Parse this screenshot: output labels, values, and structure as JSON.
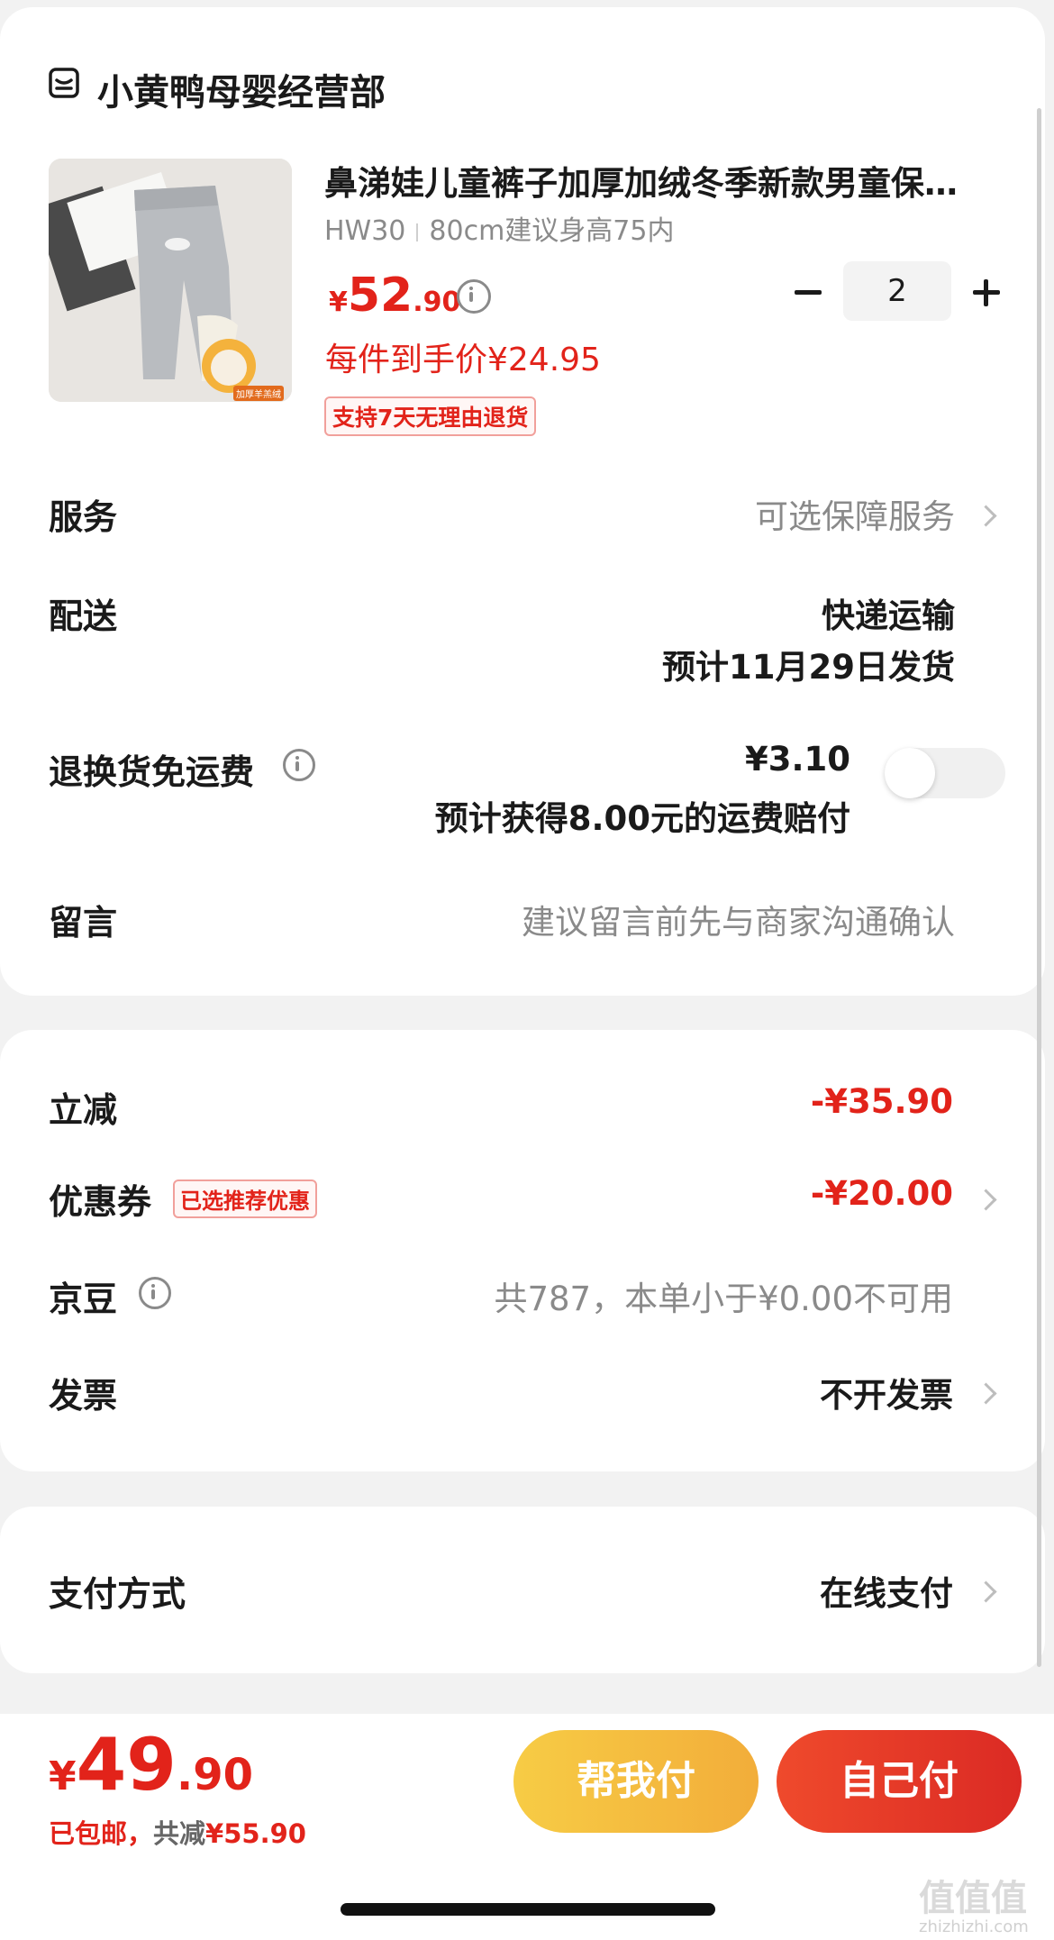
{
  "shop": {
    "name": "小黄鸭母婴经营部",
    "icon": "store-icon"
  },
  "product": {
    "title": "鼻涕娃儿童裤子加厚加绒冬季新款男童保…",
    "sku_code": "HW30",
    "sku_desc": "80cm建议身高75内",
    "price_symbol": "¥",
    "price_int": "52",
    "price_dec": ".90",
    "unit_price_label": "每件到手价¥24.95",
    "return_policy_tag": "支持7天无理由退货",
    "thumbnail_badge": "加厚羊羔绒",
    "quantity": "2"
  },
  "service": {
    "label": "服务",
    "value": "可选保障服务"
  },
  "delivery": {
    "label": "配送",
    "method": "快递运输",
    "eta": "预计11月29日发货"
  },
  "return_shipping": {
    "label": "退换货免运费",
    "price": "¥3.10",
    "desc": "预计获得8.00元的运费赔付",
    "enabled": false
  },
  "message": {
    "label": "留言",
    "placeholder": "建议留言前先与商家沟通确认"
  },
  "discounts": {
    "instant_label": "立减",
    "instant_value": "-¥35.90",
    "coupon_label": "优惠券",
    "coupon_tag": "已选推荐优惠",
    "coupon_value": "-¥20.00",
    "jingdou_label": "京豆",
    "jingdou_value": "共787，本单小于¥0.00不可用",
    "invoice_label": "发票",
    "invoice_value": "不开发票"
  },
  "payment": {
    "label": "支付方式",
    "value": "在线支付"
  },
  "footer": {
    "total_symbol": "¥",
    "total_int": "49",
    "total_dec": ".90",
    "shipping_note": "已包邮，",
    "saved_label": "共减",
    "saved_value": "¥55.90",
    "help_pay_button": "帮我付",
    "self_pay_button": "自己付"
  },
  "watermark": {
    "text": "值值值",
    "url": "zhizhizhi.com"
  },
  "colors": {
    "accent_red": "#e2231a",
    "help_pay_yellow": "#f5be3c",
    "self_pay_red": "#e8322a"
  }
}
